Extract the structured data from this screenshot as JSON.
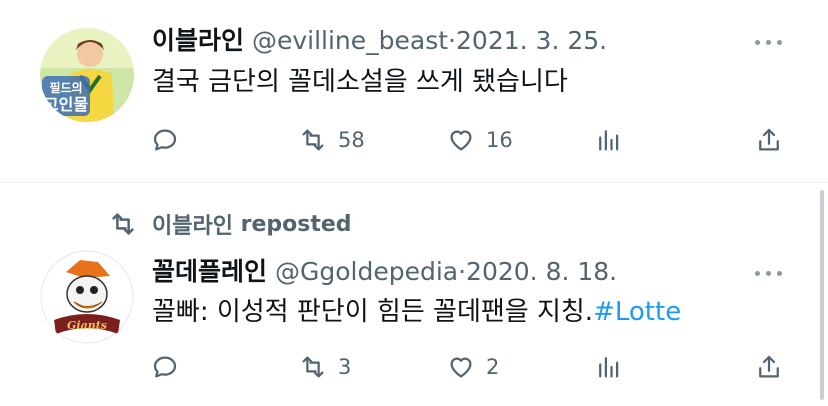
{
  "tweets": [
    {
      "display_name": "이블라인",
      "handle": "@evilline_beast",
      "separator": "·",
      "date": "2021. 3. 25.",
      "text": "결국 금단의 꼴데소설을 쓰게 됐습니다",
      "avatar_text": {
        "line1": "필드의",
        "line2": "고인물"
      },
      "counts": {
        "replies": "",
        "reposts": "58",
        "likes": "16"
      }
    },
    {
      "repost_by": "이블라인",
      "repost_word": "reposted",
      "display_name": "꼴데플레인",
      "handle": "@Ggoldepedia",
      "separator": "·",
      "date": "2020. 8. 18.",
      "text": "꼴빠: 이성적 판단이 힘든 꼴데팬을 지칭.",
      "hashtag": "#Lotte",
      "avatar_text": {
        "badge": "Giants"
      },
      "counts": {
        "replies": "",
        "reposts": "3",
        "likes": "2"
      }
    }
  ],
  "icons": {
    "reply": "speech-bubble-icon",
    "repost": "repost-arrows-icon",
    "like": "heart-outline-icon",
    "views": "bar-chart-icon",
    "share": "share-upload-icon",
    "more": "ellipsis-icon"
  },
  "colors": {
    "text": "#0f1419",
    "secondary": "#536471",
    "link": "#1d9bf0",
    "divider": "#eff3f4"
  }
}
